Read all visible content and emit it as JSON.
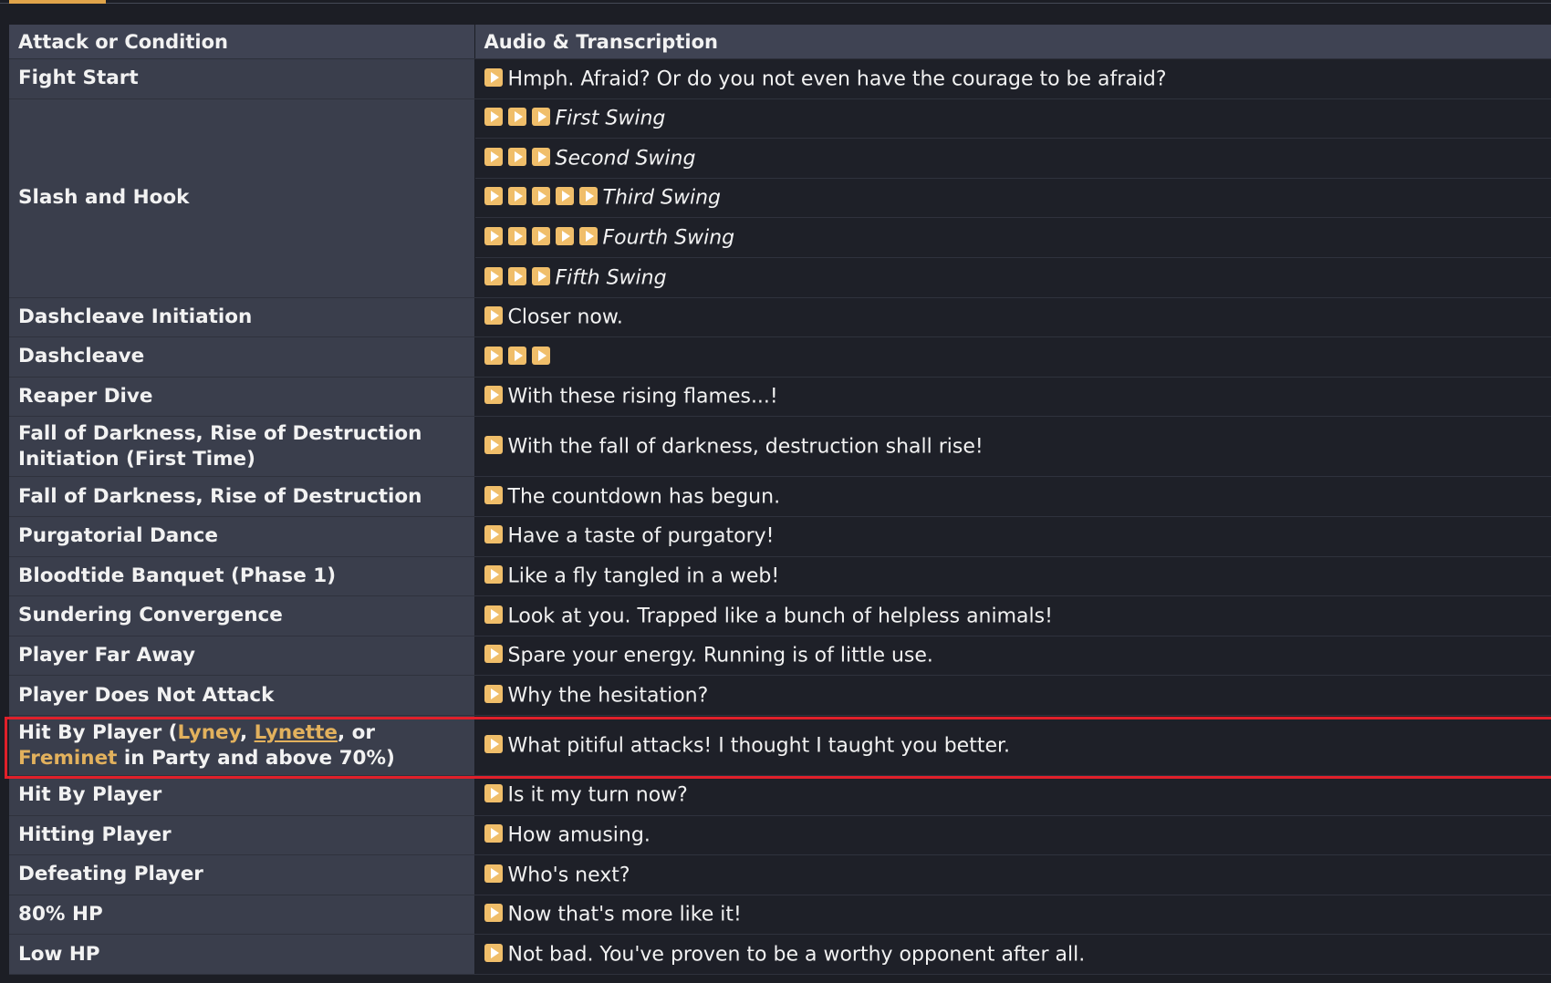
{
  "table": {
    "headers": [
      "Attack or Condition",
      "Audio & Transcription"
    ],
    "rows": [
      {
        "condition": "Fight Start",
        "lines": [
          {
            "buttons": 1,
            "text": "Hmph. Afraid? Or do you not even have the courage to be afraid?",
            "italic": false
          }
        ]
      },
      {
        "condition": "Slash and Hook",
        "lines": [
          {
            "buttons": 3,
            "text": "First Swing",
            "italic": true
          },
          {
            "buttons": 3,
            "text": "Second Swing",
            "italic": true
          },
          {
            "buttons": 5,
            "text": "Third Swing",
            "italic": true
          },
          {
            "buttons": 5,
            "text": "Fourth Swing",
            "italic": true
          },
          {
            "buttons": 3,
            "text": "Fifth Swing",
            "italic": true
          }
        ]
      },
      {
        "condition": "Dashcleave Initiation",
        "lines": [
          {
            "buttons": 1,
            "text": "Closer now.",
            "italic": false
          }
        ]
      },
      {
        "condition": "Dashcleave",
        "lines": [
          {
            "buttons": 3,
            "text": "",
            "italic": false
          }
        ]
      },
      {
        "condition": "Reaper Dive",
        "lines": [
          {
            "buttons": 1,
            "text": "With these rising flames...!",
            "italic": false
          }
        ]
      },
      {
        "condition": "Fall of Darkness, Rise of Destruction Initiation (First Time)",
        "tall": true,
        "lines": [
          {
            "buttons": 1,
            "text": "With the fall of darkness, destruction shall rise!",
            "italic": false
          }
        ]
      },
      {
        "condition": "Fall of Darkness, Rise of Destruction",
        "lines": [
          {
            "buttons": 1,
            "text": "The countdown has begun.",
            "italic": false
          }
        ]
      },
      {
        "condition": "Purgatorial Dance",
        "lines": [
          {
            "buttons": 1,
            "text": "Have a taste of purgatory!",
            "italic": false
          }
        ]
      },
      {
        "condition": "Bloodtide Banquet (Phase 1)",
        "lines": [
          {
            "buttons": 1,
            "text": "Like a fly tangled in a web!",
            "italic": false
          }
        ]
      },
      {
        "condition": "Sundering Convergence",
        "lines": [
          {
            "buttons": 1,
            "text": "Look at you. Trapped like a bunch of helpless animals!",
            "italic": false
          }
        ]
      },
      {
        "condition": "Player Far Away",
        "lines": [
          {
            "buttons": 1,
            "text": "Spare your energy. Running is of little use.",
            "italic": false
          }
        ]
      },
      {
        "condition": "Player Does Not Attack",
        "lines": [
          {
            "buttons": 1,
            "text": "Why the hesitation?",
            "italic": false
          }
        ]
      },
      {
        "condition_rich": {
          "prefix": "Hit By Player (",
          "links": [
            "Lyney",
            "Lynette",
            "Freminet"
          ],
          "sep1": ", ",
          "sep2": ", or ",
          "suffix": " in Party and above 70%)"
        },
        "tall": true,
        "highlighted": true,
        "lines": [
          {
            "buttons": 1,
            "text": "What pitiful attacks! I thought I taught you better.",
            "italic": false
          }
        ]
      },
      {
        "condition": "Hit By Player",
        "lines": [
          {
            "buttons": 1,
            "text": "Is it my turn now?",
            "italic": false
          }
        ]
      },
      {
        "condition": "Hitting Player",
        "lines": [
          {
            "buttons": 1,
            "text": "How amusing.",
            "italic": false
          }
        ]
      },
      {
        "condition": "Defeating Player",
        "lines": [
          {
            "buttons": 1,
            "text": "Who's next?",
            "italic": false
          }
        ]
      },
      {
        "condition": "80% HP",
        "lines": [
          {
            "buttons": 1,
            "text": "Now that's more like it!",
            "italic": false
          }
        ]
      },
      {
        "condition": "Low HP",
        "lines": [
          {
            "buttons": 1,
            "text": "Not bad. You've proven to be a worthy opponent after all.",
            "italic": false
          }
        ]
      }
    ]
  },
  "icons": {
    "play": "play-icon"
  },
  "colors": {
    "accent": "#f0be6a",
    "link": "#e2b15d",
    "highlight": "#e0202a",
    "header_bg": "#3f4353",
    "condition_bg": "#3a3e4c",
    "audio_bg": "#1e2028"
  }
}
